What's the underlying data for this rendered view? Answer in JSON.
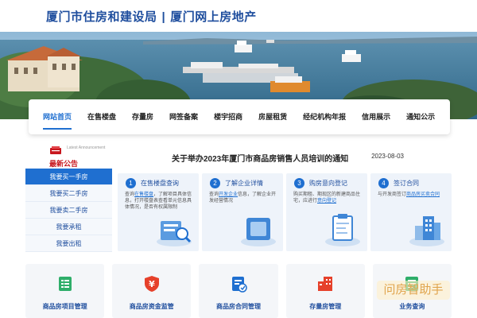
{
  "header": {
    "agency": "厦门市住房和建设局",
    "separator": "|",
    "platform": "厦门网上房地产"
  },
  "nav": {
    "items": [
      {
        "label": "网站首页",
        "active": true
      },
      {
        "label": "在售楼盘"
      },
      {
        "label": "存量房"
      },
      {
        "label": "网签备案"
      },
      {
        "label": "楼宇招商"
      },
      {
        "label": "房屋租赁"
      },
      {
        "label": "经纪机构年报"
      },
      {
        "label": "信用展示"
      },
      {
        "label": "通知公示"
      }
    ]
  },
  "sidebar": {
    "title": "最新公告",
    "subtitle_en": "Latest Announcement",
    "items": [
      {
        "label": "我要买一手房",
        "active": true
      },
      {
        "label": "我要买二手房"
      },
      {
        "label": "我要卖二手房"
      },
      {
        "label": "我要承租"
      },
      {
        "label": "我要出租"
      }
    ]
  },
  "notice": {
    "title": "关于举办2023年厦门市商品房销售人员培训的通知",
    "date": "2023-08-03"
  },
  "steps": [
    {
      "num": "1",
      "title": "在售楼盘查询",
      "desc_pre": "查询",
      "link": "在售楼盘",
      "desc_post": "，了解项目具体信息，打开楼盘表查看单元信息具体情况，是否有权属限制"
    },
    {
      "num": "2",
      "title": "了解企业详情",
      "desc_pre": "查询",
      "link": "开发企业",
      "desc_post": "信息，了解企业开发经营情况"
    },
    {
      "num": "3",
      "title": "购房意向登记",
      "desc_pre": "购买期租、期现区的新建商品住宅，应进行",
      "link": "意向登记",
      "desc_post": ""
    },
    {
      "num": "4",
      "title": "签订合同",
      "desc_pre": "与开发商签订",
      "link": "商品房买卖合同",
      "desc_post": ""
    }
  ],
  "cards": [
    {
      "label": "商品房项目管理",
      "icon": "document-list-icon",
      "color": "#2fae6a"
    },
    {
      "label": "商品房资金监管",
      "icon": "yuan-shield-icon",
      "color": "#e6412b"
    },
    {
      "label": "商品房合同管理",
      "icon": "contract-icon",
      "color": "#1f6fd0"
    },
    {
      "label": "存量房管理",
      "icon": "building-icon",
      "color": "#e6412b"
    },
    {
      "label": "业务查询",
      "icon": "query-icon",
      "color": "#2fae6a"
    }
  ],
  "watermark": "问房智助手"
}
